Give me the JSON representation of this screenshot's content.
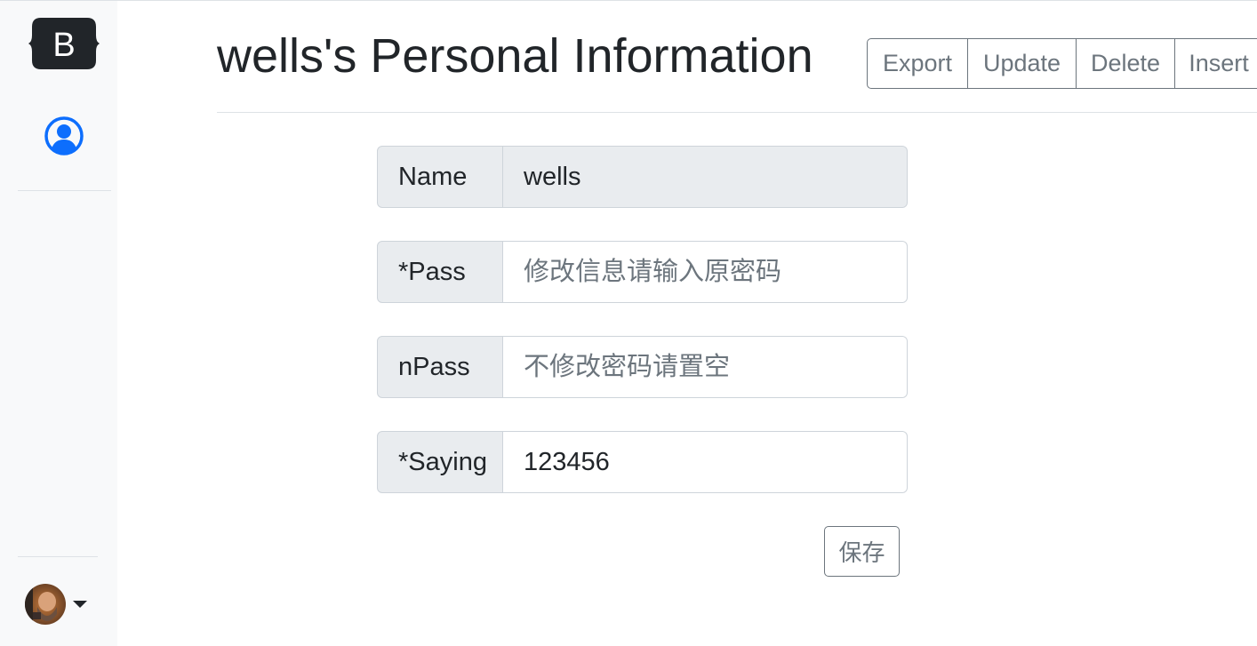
{
  "page": {
    "title": "wells's Personal Information"
  },
  "toolbar": {
    "export_label": "Export",
    "update_label": "Update",
    "delete_label": "Delete",
    "insert_label": "Insert"
  },
  "sidebar": {
    "brand_icon": "bootstrap-logo-icon",
    "profile_icon": "person-circle-icon",
    "accent_color": "#0d6efd"
  },
  "form": {
    "name": {
      "label": "Name",
      "value": "wells"
    },
    "pass": {
      "label": "*Pass",
      "value": "",
      "placeholder": "修改信息请输入原密码"
    },
    "npass": {
      "label": "nPass",
      "value": "",
      "placeholder": "不修改密码请置空"
    },
    "saying": {
      "label": "*Saying",
      "value": "123456"
    },
    "save_label": "保存"
  }
}
